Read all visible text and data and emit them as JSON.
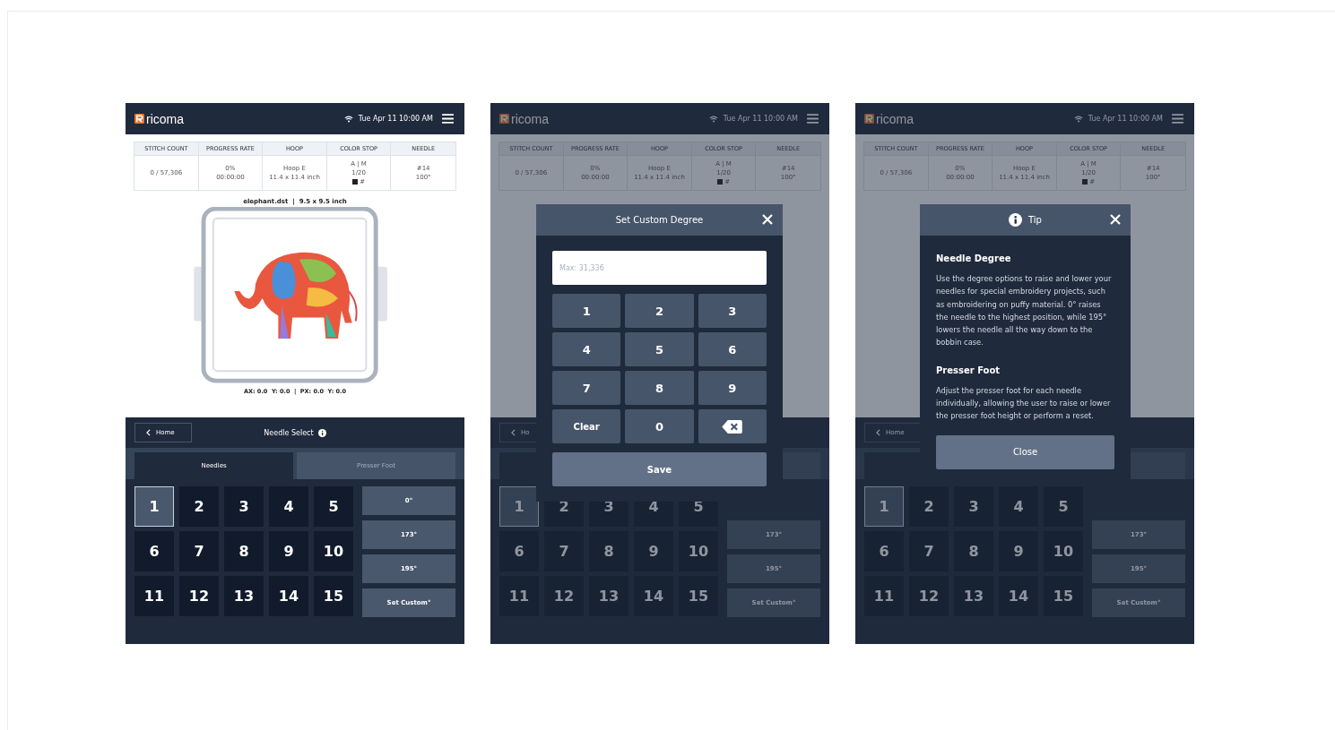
{
  "screens": [
    {
      "dimmed": false,
      "header": {
        "logo": "ricoma",
        "datetime": "Tue Apr 11  10:00 AM"
      },
      "status_table": {
        "columns": [
          "STITCH COUNT",
          "PROGRESS RATE",
          "HOOP",
          "COLOR STOP",
          "NEEDLE"
        ],
        "cells": [
          {
            "lines": [
              "0 / 57,306"
            ]
          },
          {
            "lines": [
              "0%",
              "00:00:00"
            ]
          },
          {
            "lines": [
              "Hoop E",
              "11.4 x 11.4 inch"
            ]
          },
          {
            "lines": [
              "A | M",
              "1/20"
            ],
            "swatch": "#"
          },
          {
            "lines": [
              "#14",
              "100°"
            ]
          }
        ]
      },
      "file_info": "elephant.dst  |  9.5 x 9.5 inch",
      "show_preview": true,
      "coordinates": "AX: 0.0  Y: 0.0  |  PX: 0.0  Y: 0.0",
      "nav": {
        "back": "Home",
        "title": "Needle Select"
      },
      "tabs": [
        {
          "label": "Needles",
          "selected": true
        },
        {
          "label": "Presser Foot",
          "selected": false
        }
      ],
      "needles": [
        {
          "label": "1",
          "selected": true
        },
        {
          "label": "2",
          "selected": false
        },
        {
          "label": "3",
          "selected": false
        },
        {
          "label": "4",
          "selected": false
        },
        {
          "label": "5",
          "selected": false
        },
        {
          "label": "6",
          "selected": false
        },
        {
          "label": "7",
          "selected": false
        },
        {
          "label": "8",
          "selected": false
        },
        {
          "label": "9",
          "selected": false
        },
        {
          "label": "10",
          "selected": false
        },
        {
          "label": "11",
          "selected": false
        },
        {
          "label": "12",
          "selected": false
        },
        {
          "label": "13",
          "selected": false
        },
        {
          "label": "14",
          "selected": false
        },
        {
          "label": "15",
          "selected": false
        }
      ],
      "degrees": [
        {
          "label": "0°"
        },
        {
          "label": "173°"
        },
        {
          "label": "195°"
        },
        {
          "label": "Set Custom°"
        }
      ]
    },
    {
      "dimmed": true,
      "header": {
        "logo": "ricoma",
        "datetime": "Tue Apr 11  10:00 AM"
      },
      "status_table": {
        "columns": [
          "STITCH COUNT",
          "PROGRESS RATE",
          "HOOP",
          "COLOR STOP",
          "NEEDLE"
        ],
        "cells": [
          {
            "lines": [
              "0 / 57,306"
            ]
          },
          {
            "lines": [
              "0%",
              "00:00:00"
            ]
          },
          {
            "lines": [
              "Hoop E",
              "11.4 x 11.4 inch"
            ]
          },
          {
            "lines": [
              "A | M",
              "1/20"
            ],
            "swatch": "#"
          },
          {
            "lines": [
              "#14",
              "100°"
            ]
          }
        ]
      },
      "show_preview": false,
      "nav": {
        "back": "Ho"
      },
      "tabs": [
        {
          "selected": true
        },
        {
          "selected": false
        }
      ],
      "needles": [
        {
          "label": "1",
          "selected": true
        },
        {
          "label": "2",
          "selected": false
        },
        {
          "label": "3",
          "selected": false
        },
        {
          "label": "4",
          "selected": false
        },
        {
          "label": "5",
          "selected": false
        },
        {
          "label": "6",
          "selected": false
        },
        {
          "label": "7",
          "selected": false
        },
        {
          "label": "8",
          "selected": false
        },
        {
          "label": "9",
          "selected": false
        },
        {
          "label": "10",
          "selected": false
        },
        {
          "label": "11",
          "selected": false
        },
        {
          "label": "12",
          "selected": false
        },
        {
          "label": "13",
          "selected": false
        },
        {
          "label": "14",
          "selected": false
        },
        {
          "label": "15",
          "selected": false
        }
      ],
      "degrees": [
        {
          "label": "173°"
        },
        {
          "label": "195°"
        },
        {
          "label": "Set Custom°"
        }
      ],
      "modal": {
        "kind": "keypad",
        "title": "Set Custom Degree",
        "placeholder": "Max: 31,336",
        "keys": [
          {
            "kind": "digit",
            "label": "1"
          },
          {
            "kind": "digit",
            "label": "2"
          },
          {
            "kind": "digit",
            "label": "3"
          },
          {
            "kind": "digit",
            "label": "4"
          },
          {
            "kind": "digit",
            "label": "5"
          },
          {
            "kind": "digit",
            "label": "6"
          },
          {
            "kind": "digit",
            "label": "7"
          },
          {
            "kind": "digit",
            "label": "8"
          },
          {
            "kind": "digit",
            "label": "9"
          },
          {
            "kind": "action",
            "label": "Clear"
          },
          {
            "kind": "digit",
            "label": "0"
          },
          {
            "kind": "backspace"
          }
        ],
        "submit": "Save"
      }
    },
    {
      "dimmed": true,
      "header": {
        "logo": "ricoma",
        "datetime": "Tue Apr 11  10:00 AM"
      },
      "status_table": {
        "columns": [
          "STITCH COUNT",
          "PROGRESS RATE",
          "HOOP",
          "COLOR STOP",
          "NEEDLE"
        ],
        "cells": [
          {
            "lines": [
              "0 / 57,306"
            ]
          },
          {
            "lines": [
              "0%",
              "00:00:00"
            ]
          },
          {
            "lines": [
              "Hoop E",
              "11.4 x 11.4 inch"
            ]
          },
          {
            "lines": [
              "A | M",
              "1/20"
            ],
            "swatch": "#"
          },
          {
            "lines": [
              "#14",
              "100°"
            ]
          }
        ]
      },
      "show_preview": false,
      "nav": {
        "back": "Home"
      },
      "tabs": [
        {
          "selected": true
        },
        {
          "selected": false
        }
      ],
      "needles": [
        {
          "label": "1",
          "selected": true
        },
        {
          "label": "2",
          "selected": false
        },
        {
          "label": "3",
          "selected": false
        },
        {
          "label": "4",
          "selected": false
        },
        {
          "label": "5",
          "selected": false
        },
        {
          "label": "6",
          "selected": false
        },
        {
          "label": "7",
          "selected": false
        },
        {
          "label": "8",
          "selected": false
        },
        {
          "label": "9",
          "selected": false
        },
        {
          "label": "10",
          "selected": false
        },
        {
          "label": "11",
          "selected": false
        },
        {
          "label": "12",
          "selected": false
        },
        {
          "label": "13",
          "selected": false
        },
        {
          "label": "14",
          "selected": false
        },
        {
          "label": "15",
          "selected": false
        }
      ],
      "degrees": [
        {
          "label": "173°"
        },
        {
          "label": "195°"
        },
        {
          "label": "Set Custom°"
        }
      ],
      "modal": {
        "kind": "tip",
        "title": "Tip",
        "sections": [
          {
            "heading": "Needle Degree",
            "text": "Use the degree options to raise and lower your needles for special embroidery projects, such as embroidering on puffy material. 0° raises the needle to the highest position, while 195° lowers the needle all the way down to the bobbin case."
          },
          {
            "heading": "Presser Foot",
            "text": "Adjust the presser foot for each needle individually, allowing the user to raise or lower the presser foot height or perform a reset."
          }
        ],
        "submit": "Close"
      }
    }
  ]
}
